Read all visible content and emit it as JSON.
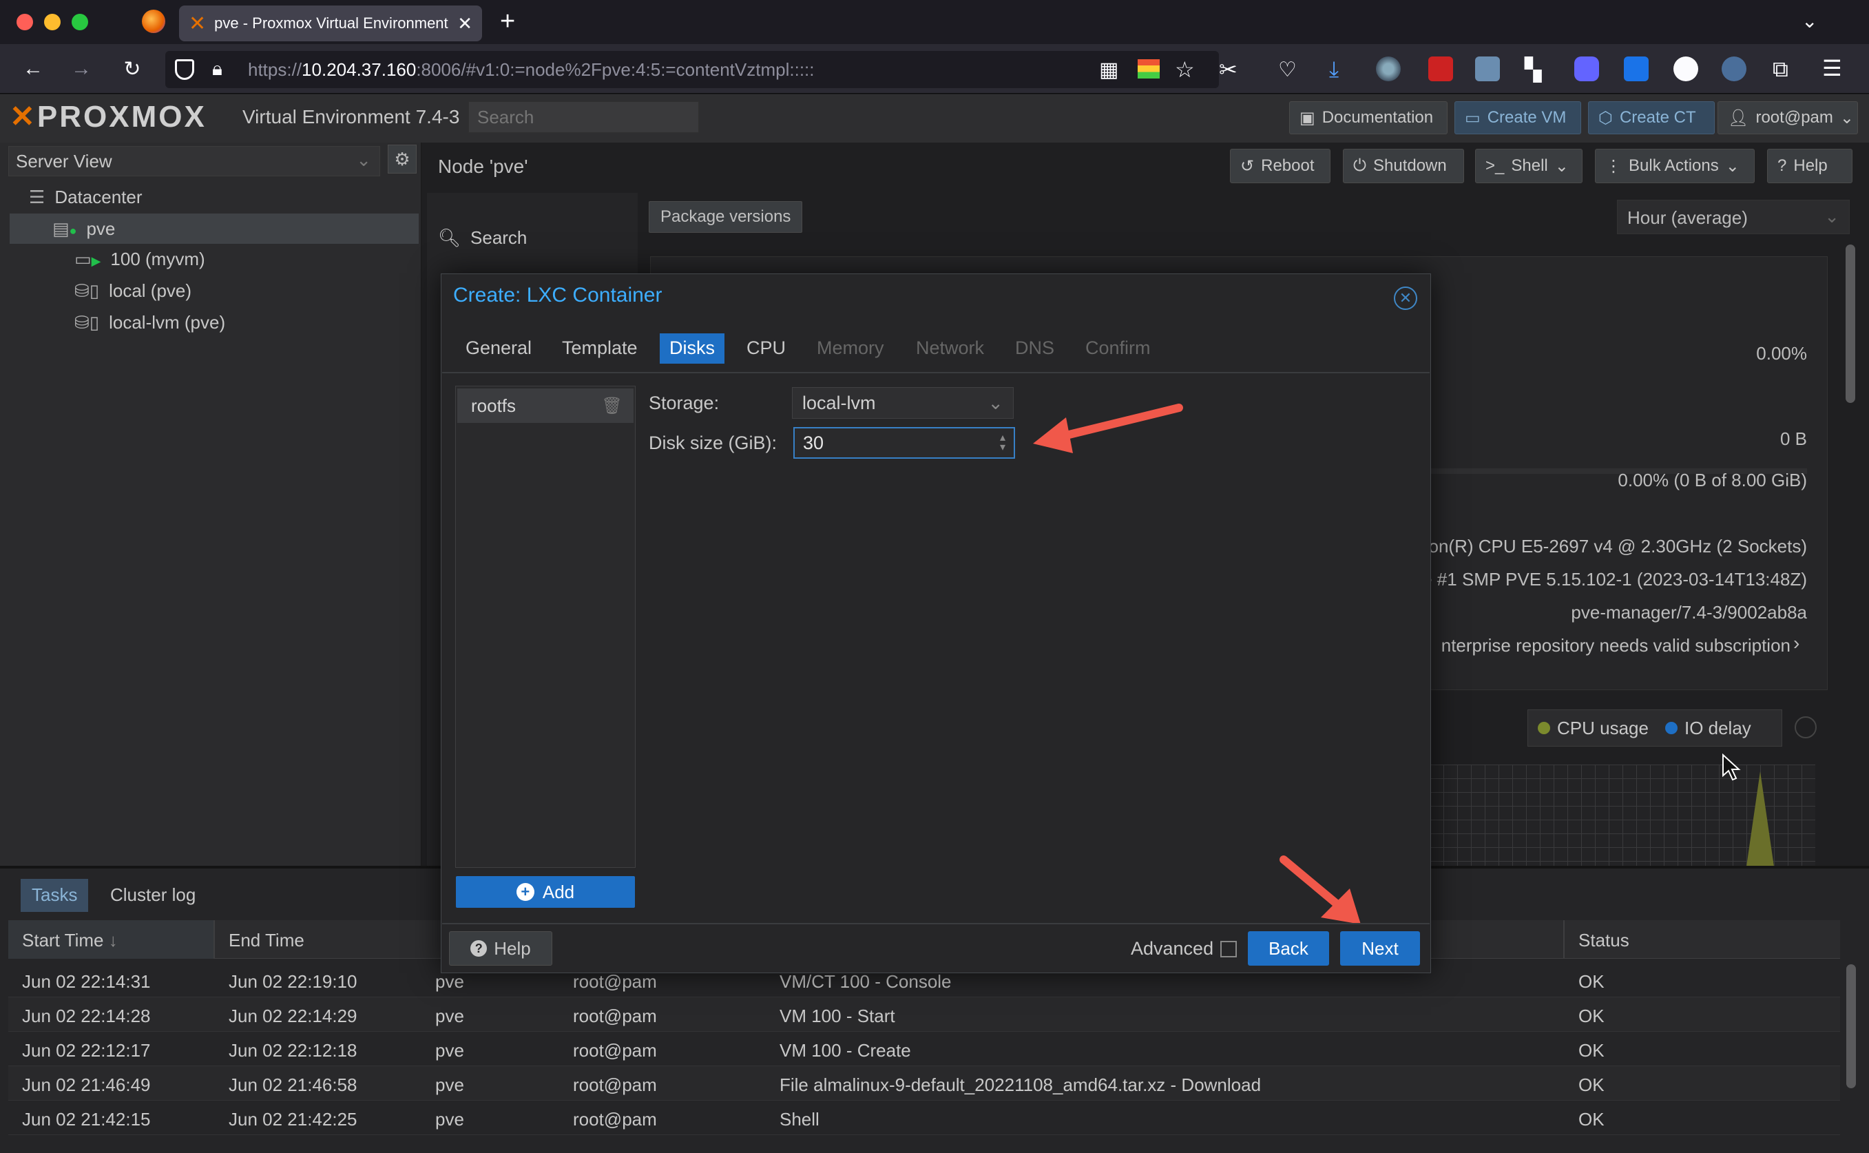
{
  "browser": {
    "tab_title": "pve - Proxmox Virtual Environment",
    "url_prefix": "https://",
    "url_host": "10.204.37.160",
    "url_rest": ":8006/#v1:0:=node%2Fpve:4:5:=contentVztmpl:::::"
  },
  "header": {
    "logo": "PROXMOX",
    "version": "Virtual Environment 7.4-3",
    "search_placeholder": "Search",
    "documentation": "Documentation",
    "create_vm": "Create VM",
    "create_ct": "Create CT",
    "user": "root@pam"
  },
  "tree": {
    "view": "Server View",
    "items": [
      {
        "label": "Datacenter"
      },
      {
        "label": "pve"
      },
      {
        "label": "100 (myvm)"
      },
      {
        "label": "local (pve)"
      },
      {
        "label": "local-lvm (pve)"
      }
    ]
  },
  "node": {
    "title": "Node 'pve'",
    "reboot": "Reboot",
    "shutdown": "Shutdown",
    "shell": "Shell",
    "bulk_actions": "Bulk Actions",
    "help": "Help",
    "search": "Search",
    "package_versions": "Package versions",
    "timeframe": "Hour (average)"
  },
  "summary": {
    "cpu_pct": "0.00%",
    "bytes": "0 B",
    "swap": "0.00% (0 B of 8.00 GiB)",
    "cpu_model": "on(R) CPU E5-2697 v4 @ 2.30GHz (2 Sockets)",
    "kernel": "e #1 SMP PVE 5.15.102-1 (2023-03-14T13:48Z)",
    "manager": "pve-manager/7.4-3/9002ab8a",
    "repo": "nterprise repository needs valid subscription",
    "legend_cpu": "CPU usage",
    "legend_io": "IO delay"
  },
  "dialog": {
    "title": "Create: LXC Container",
    "tabs": [
      "General",
      "Template",
      "Disks",
      "CPU",
      "Memory",
      "Network",
      "DNS",
      "Confirm"
    ],
    "disk_item": "rootfs",
    "add": "Add",
    "storage_label": "Storage:",
    "storage_value": "local-lvm",
    "disk_size_label": "Disk size (GiB):",
    "disk_size_value": "30",
    "help": "Help",
    "advanced": "Advanced",
    "back": "Back",
    "next": "Next"
  },
  "tasks": {
    "tabs": [
      "Tasks",
      "Cluster log"
    ],
    "columns": [
      "Start Time",
      "End Time",
      "Status"
    ],
    "rows": [
      {
        "start": "Jun 02 22:14:31",
        "end": "Jun 02 22:19:10",
        "node": "pve",
        "user": "root@pam",
        "desc": "VM/CT 100 - Console",
        "status": "OK"
      },
      {
        "start": "Jun 02 22:14:28",
        "end": "Jun 02 22:14:29",
        "node": "pve",
        "user": "root@pam",
        "desc": "VM 100 - Start",
        "status": "OK"
      },
      {
        "start": "Jun 02 22:12:17",
        "end": "Jun 02 22:12:18",
        "node": "pve",
        "user": "root@pam",
        "desc": "VM 100 - Create",
        "status": "OK"
      },
      {
        "start": "Jun 02 21:46:49",
        "end": "Jun 02 21:46:58",
        "node": "pve",
        "user": "root@pam",
        "desc": "File almalinux-9-default_20221108_amd64.tar.xz - Download",
        "status": "OK"
      },
      {
        "start": "Jun 02 21:42:15",
        "end": "Jun 02 21:42:25",
        "node": "pve",
        "user": "root@pam",
        "desc": "Shell",
        "status": "OK"
      }
    ]
  },
  "colors": {
    "accent": "#1e6fc4",
    "title_blue": "#3daeff",
    "annotation_arrow": "#f0584a",
    "proxmox_orange": "#e57000"
  }
}
